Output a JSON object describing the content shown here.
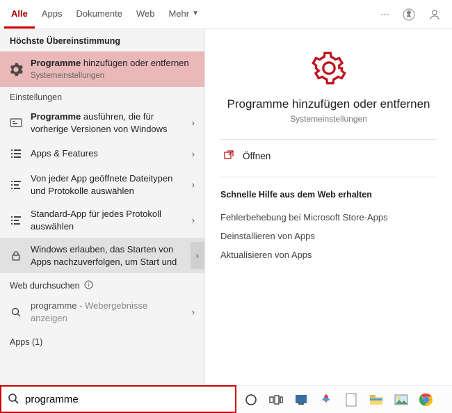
{
  "tabs": {
    "alle": "Alle",
    "apps": "Apps",
    "dokumente": "Dokumente",
    "web": "Web",
    "mehr": "Mehr"
  },
  "left": {
    "best_match_header": "Höchste Übereinstimmung",
    "best_match": {
      "title_bold": "Programme",
      "title_rest": " hinzufügen oder entfernen",
      "sub": "Systemeinstellungen"
    },
    "settings_header": "Einstellungen",
    "settings": [
      {
        "bold": "Programme",
        "rest": " ausführen, die für vorherige Versionen von Windows"
      },
      {
        "bold": "",
        "rest": "Apps & Features"
      },
      {
        "bold": "",
        "rest": "Von jeder App geöffnete Dateitypen und Protokolle auswählen"
      },
      {
        "bold": "",
        "rest": "Standard-App für jedes Protokoll auswählen"
      },
      {
        "bold": "",
        "rest": "Windows erlauben, das Starten von Apps nachzuverfolgen, um Start und"
      }
    ],
    "web_header": "Web durchsuchen",
    "web_result": {
      "bold": "programme",
      "rest": " - Webergebnisse anzeigen"
    },
    "apps_header": "Apps (1)"
  },
  "right": {
    "title": "Programme hinzufügen oder entfernen",
    "sub": "Systemeinstellungen",
    "open": "Öffnen",
    "help_header": "Schnelle Hilfe aus dem Web erhalten",
    "help_links": [
      "Fehlerbehebung bei Microsoft Store-Apps",
      "Deinstallieren von Apps",
      "Aktualisieren von Apps"
    ]
  },
  "search": {
    "value": "programme"
  }
}
